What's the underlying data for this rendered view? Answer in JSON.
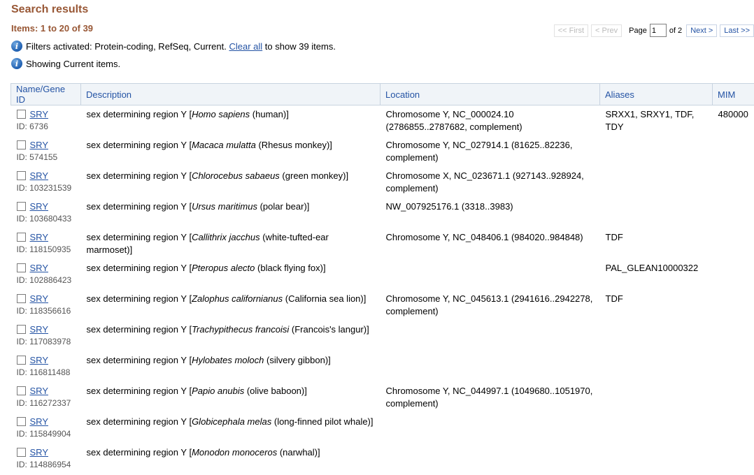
{
  "header": {
    "title": "Search results",
    "items_count": "Items: 1 to 20 of 39"
  },
  "pager": {
    "first": "<< First",
    "prev": "< Prev",
    "page_label": "Page",
    "page_value": "1",
    "of_label": "of 2",
    "next": "Next >",
    "last": "Last >>"
  },
  "notices": {
    "filters_prefix": "Filters activated: Protein-coding, RefSeq, Current.",
    "clear_all": "Clear all",
    "filters_suffix": "to show 39 items.",
    "showing": "Showing Current items."
  },
  "columns": [
    "Name/Gene ID",
    "Description",
    "Location",
    "Aliases",
    "MIM"
  ],
  "rows": [
    {
      "name": "SRY",
      "id": "ID: 6736",
      "desc_pre": "sex determining region Y [",
      "species": "Homo sapiens",
      "common": " (human)]",
      "location": "Chromosome Y, NC_000024.10 (2786855..2787682, complement)",
      "aliases": "SRXX1, SRXY1, TDF, TDY",
      "mim": "480000"
    },
    {
      "name": "SRY",
      "id": "ID: 574155",
      "desc_pre": "sex determining region Y [",
      "species": "Macaca mulatta",
      "common": " (Rhesus monkey)]",
      "location": "Chromosome Y, NC_027914.1 (81625..82236, complement)",
      "aliases": "",
      "mim": ""
    },
    {
      "name": "SRY",
      "id": "ID: 103231539",
      "desc_pre": "sex determining region Y [",
      "species": "Chlorocebus sabaeus",
      "common": " (green monkey)]",
      "location": "Chromosome X, NC_023671.1 (927143..928924, complement)",
      "aliases": "",
      "mim": ""
    },
    {
      "name": "SRY",
      "id": "ID: 103680433",
      "desc_pre": "sex determining region Y [",
      "species": "Ursus maritimus",
      "common": " (polar bear)]",
      "location": "NW_007925176.1 (3318..3983)",
      "aliases": "",
      "mim": ""
    },
    {
      "name": "SRY",
      "id": "ID: 118150935",
      "desc_pre": "sex determining region Y [",
      "species": "Callithrix jacchus",
      "common": " (white-tufted-ear marmoset)]",
      "location": "Chromosome Y, NC_048406.1 (984020..984848)",
      "aliases": "TDF",
      "mim": ""
    },
    {
      "name": "SRY",
      "id": "ID: 102886423",
      "desc_pre": "sex determining region Y [",
      "species": "Pteropus alecto",
      "common": " (black flying fox)]",
      "location": "",
      "aliases": "PAL_GLEAN10000322",
      "mim": ""
    },
    {
      "name": "SRY",
      "id": "ID: 118356616",
      "desc_pre": "sex determining region Y [",
      "species": "Zalophus californianus",
      "common": " (California sea lion)]",
      "location": "Chromosome Y, NC_045613.1 (2941616..2942278, complement)",
      "aliases": "TDF",
      "mim": ""
    },
    {
      "name": "SRY",
      "id": "ID: 117083978",
      "desc_pre": "sex determining region Y [",
      "species": "Trachypithecus francoisi",
      "common": " (Francois's langur)]",
      "location": "",
      "aliases": "",
      "mim": ""
    },
    {
      "name": "SRY",
      "id": "ID: 116811488",
      "desc_pre": "sex determining region Y [",
      "species": "Hylobates moloch",
      "common": " (silvery gibbon)]",
      "location": "",
      "aliases": "",
      "mim": ""
    },
    {
      "name": "SRY",
      "id": "ID: 116272337",
      "desc_pre": "sex determining region Y [",
      "species": "Papio anubis",
      "common": " (olive baboon)]",
      "location": "Chromosome Y, NC_044997.1 (1049680..1051970, complement)",
      "aliases": "",
      "mim": ""
    },
    {
      "name": "SRY",
      "id": "ID: 115849904",
      "desc_pre": "sex determining region Y [",
      "species": "Globicephala melas",
      "common": " (long-finned pilot whale)]",
      "location": "",
      "aliases": "",
      "mim": ""
    },
    {
      "name": "SRY",
      "id": "ID: 114886954",
      "desc_pre": "sex determining region Y [",
      "species": "Monodon monoceros",
      "common": " (narwhal)]",
      "location": "",
      "aliases": "",
      "mim": ""
    }
  ]
}
